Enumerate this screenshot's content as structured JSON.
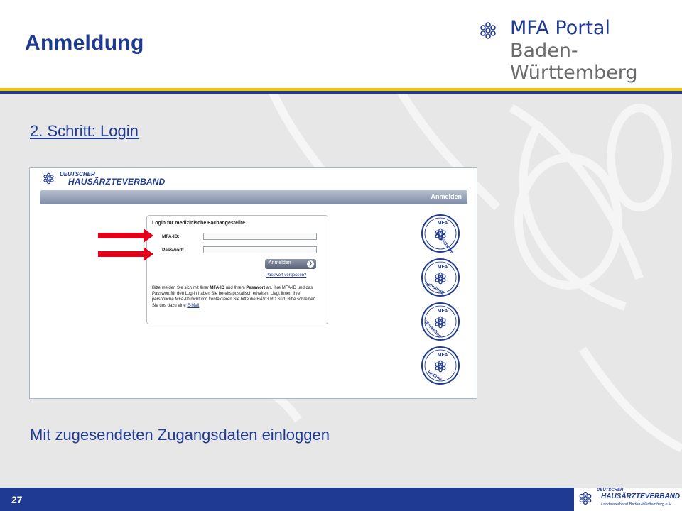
{
  "slide": {
    "title": "Anmeldung",
    "step_link": "2. Schritt: Login",
    "caption": "Mit zugesendeten Zugangsdaten einloggen",
    "page_number": "27"
  },
  "portal_logo": {
    "line1": "MFA Portal",
    "line2": "Baden-Württemberg"
  },
  "screenshot": {
    "header_logo": {
      "small": "DEUTSCHER",
      "big": "HAUSÄRZTEVERBAND"
    },
    "nav_label": "Anmelden",
    "login": {
      "title": "Login für medizinische Fachangestellte",
      "mfa_id_label": "MFA-ID:",
      "password_label": "Passwort:",
      "submit_label": "Anmelden",
      "forgot_password": "Passwort vergessen?",
      "help_part1": "Bitte melden Sie sich mit Ihrer ",
      "help_bold1": "MFA-ID",
      "help_part2": " und Ihrem ",
      "help_bold2": "Passwort",
      "help_part3": " an. Ihre MFA-ID und das Passwort für den Log-in haben Sie bereits postalisch erhalten. Liegt Ihnen Ihre persönliche MFA-ID nicht vor, kontaktieren Sie bitte die HÄVG RD Süd. Bitte schreiben Sie uns dazu eine ",
      "help_link": "E-Mail",
      "help_end": "."
    },
    "badges": [
      {
        "top": "MFA",
        "bottom": "Qualitätszirkel"
      },
      {
        "top": "MFA",
        "bottom": "Schulung"
      },
      {
        "top": "MFA",
        "bottom": "Workshop"
      },
      {
        "top": "MFA",
        "bottom": "Hotline"
      }
    ]
  },
  "footer_logo": {
    "small": "DEUTSCHER",
    "big": "HAUSÄRZTEVERBAND",
    "sub": "Landesverband Baden-Württemberg e.V."
  },
  "colors": {
    "brand_blue": "#1f3a93",
    "accent_yellow": "#f2c500",
    "arrow_red": "#e3001b",
    "content_bg": "#e7e7e7"
  }
}
